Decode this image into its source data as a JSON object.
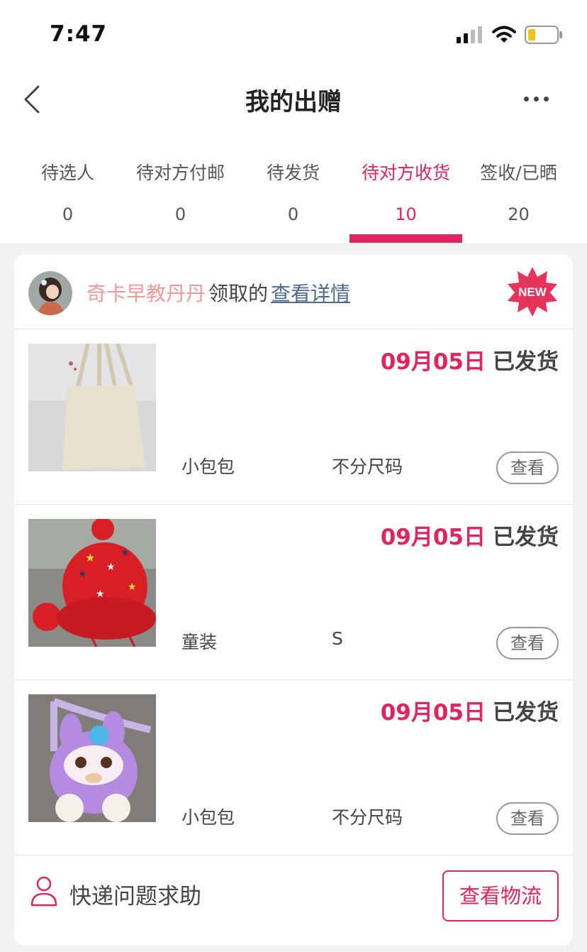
{
  "status_bar": {
    "time": "7:47"
  },
  "nav": {
    "title": "我的出赠"
  },
  "tabs": [
    {
      "label": "待选人",
      "count": "0"
    },
    {
      "label": "待对方付邮",
      "count": "0"
    },
    {
      "label": "待发货",
      "count": "0"
    },
    {
      "label": "待对方收货",
      "count": "10",
      "active": true
    },
    {
      "label": "签收/已晒",
      "count": "20"
    }
  ],
  "order": {
    "recipient_name": "奇卡早教丹丹",
    "received_text": "领取的",
    "details_link": "查看详情",
    "badge": "NEW",
    "items": [
      {
        "date": "09月05日",
        "status": "已发货",
        "category": "小包包",
        "size": "不分尺码",
        "view_label": "查看",
        "image": "tote-bag"
      },
      {
        "date": "09月05日",
        "status": "已发货",
        "category": "童装",
        "size": "S",
        "view_label": "查看",
        "image": "red-knit-hat"
      },
      {
        "date": "09月05日",
        "status": "已发货",
        "category": "小包包",
        "size": "不分尺码",
        "view_label": "查看",
        "image": "purple-bunny-bag"
      }
    ],
    "help_text": "快递问题求助",
    "logistics_button": "查看物流"
  },
  "colors": {
    "accent": "#e0245e",
    "recipient": "#ee9a9a",
    "link": "#4e6a93"
  }
}
